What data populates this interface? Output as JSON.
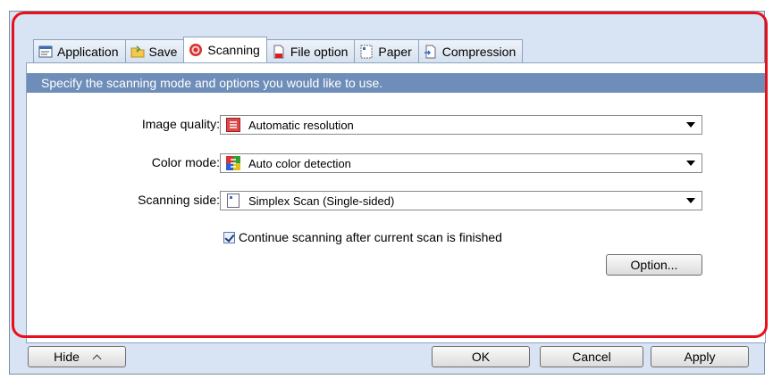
{
  "tabs": [
    {
      "label": "Application",
      "icon": "application-icon"
    },
    {
      "label": "Save",
      "icon": "folder-icon"
    },
    {
      "label": "Scanning",
      "icon": "scanning-icon",
      "active": true
    },
    {
      "label": "File option",
      "icon": "file-option-icon"
    },
    {
      "label": "Paper",
      "icon": "paper-icon"
    },
    {
      "label": "Compression",
      "icon": "compression-icon"
    }
  ],
  "banner": "Specify the scanning mode and options you would like to use.",
  "fields": {
    "image_quality": {
      "label": "Image quality:",
      "value": "Automatic resolution",
      "icon": "image-quality-icon"
    },
    "color_mode": {
      "label": "Color mode:",
      "value": "Auto color detection",
      "icon": "color-mode-icon"
    },
    "scanning_side": {
      "label": "Scanning side:",
      "value": "Simplex Scan (Single-sided)",
      "icon": "simplex-scan-icon"
    }
  },
  "continue_scanning": {
    "label": "Continue scanning after current scan is finished",
    "checked": true
  },
  "buttons": {
    "option": "Option...",
    "hide": "Hide",
    "ok": "OK",
    "cancel": "Cancel",
    "apply": "Apply"
  },
  "colors": {
    "highlight": "#e8101c",
    "banner": "#6e8db8",
    "window_bg": "#d8e4f3"
  }
}
